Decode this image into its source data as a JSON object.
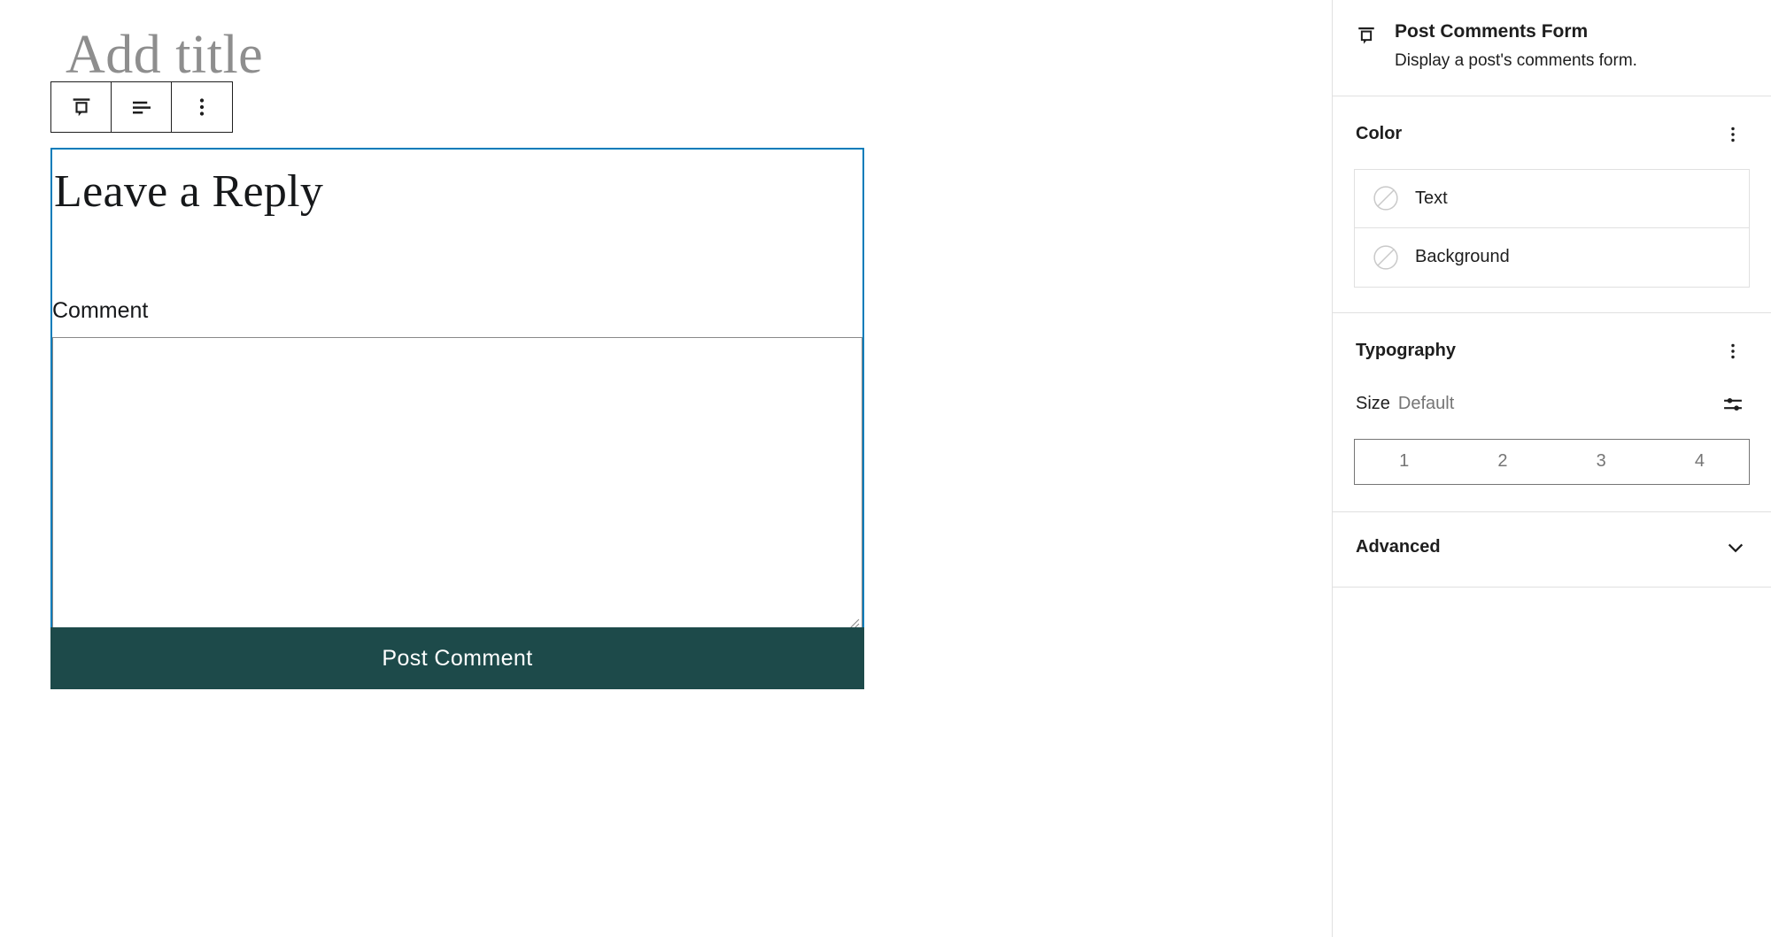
{
  "editor": {
    "title_placeholder": "Add title",
    "toolbar": {
      "block_type_label": "Post Comments Form",
      "align_label": "Align",
      "options_label": "Options"
    },
    "block": {
      "heading": "Leave a Reply",
      "comment_field_label": "Comment",
      "comment_field_value": "",
      "submit_label": "Post Comment",
      "submit_color": "#1d4a4a",
      "selection_color": "#007cba"
    }
  },
  "sidebar": {
    "block_card": {
      "icon": "post-comments-form-icon",
      "title": "Post Comments Form",
      "description": "Display a post's comments form."
    },
    "color_panel": {
      "title": "Color",
      "menu_icon": "kebab-menu-icon",
      "items": [
        {
          "label": "Text",
          "value": "none",
          "swatch_icon": "no-color-icon"
        },
        {
          "label": "Background",
          "value": "none",
          "swatch_icon": "no-color-icon"
        }
      ]
    },
    "typography_panel": {
      "title": "Typography",
      "menu_icon": "kebab-menu-icon",
      "size": {
        "label": "Size",
        "value": "Default",
        "custom_icon": "sliders-icon",
        "steps": [
          "1",
          "2",
          "3",
          "4"
        ],
        "selected_step": null
      }
    },
    "advanced_panel": {
      "title": "Advanced",
      "expand_icon": "chevron-down-icon"
    }
  }
}
